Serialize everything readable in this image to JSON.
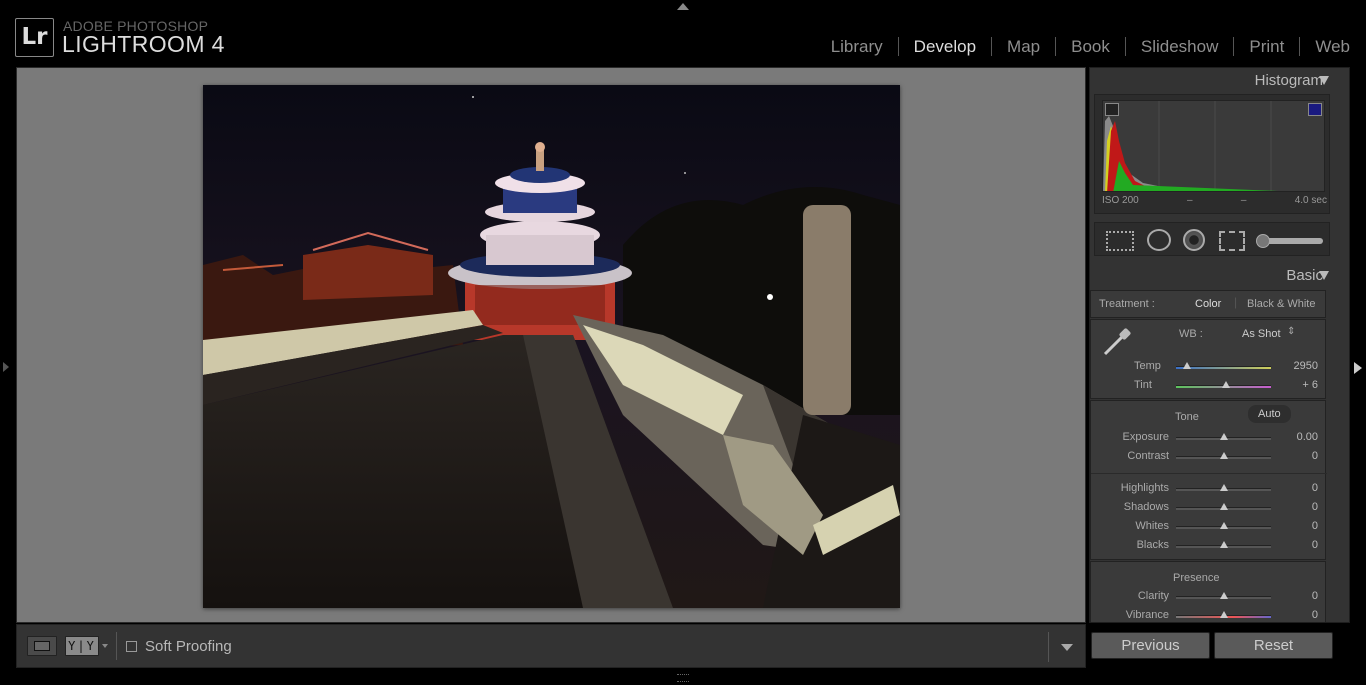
{
  "app": {
    "logo_text": "Lr",
    "brand_top": "ADOBE PHOTOSHOP",
    "brand_main": "LIGHTROOM 4"
  },
  "modules": [
    "Library",
    "Develop",
    "Map",
    "Book",
    "Slideshow",
    "Print",
    "Web"
  ],
  "active_module": "Develop",
  "toolbar": {
    "yy_label": "Y|Y",
    "soft_proofing_label": "Soft Proofing"
  },
  "histogram": {
    "title": "Histogram",
    "iso": "ISO 200",
    "focal": "–",
    "aperture": "–",
    "shutter": "4.0 sec"
  },
  "basic": {
    "title": "Basic",
    "treatment_label": "Treatment :",
    "treatment_color": "Color",
    "treatment_bw": "Black & White",
    "wb_label": "WB :",
    "wb_value": "As Shot",
    "temp_label": "Temp",
    "temp_value": "2950",
    "temp_position": 0.12,
    "tint_label": "Tint",
    "tint_value": "+ 6",
    "tint_position": 0.53,
    "tone_label": "Tone",
    "auto_label": "Auto",
    "sliders_tone": [
      {
        "label": "Exposure",
        "value": "0.00",
        "position": 0.5
      },
      {
        "label": "Contrast",
        "value": "0",
        "position": 0.5
      }
    ],
    "sliders_tone2": [
      {
        "label": "Highlights",
        "value": "0",
        "position": 0.5
      },
      {
        "label": "Shadows",
        "value": "0",
        "position": 0.5
      },
      {
        "label": "Whites",
        "value": "0",
        "position": 0.5
      },
      {
        "label": "Blacks",
        "value": "0",
        "position": 0.5
      }
    ],
    "presence_label": "Presence",
    "sliders_presence": [
      {
        "label": "Clarity",
        "value": "0",
        "position": 0.5
      },
      {
        "label": "Vibrance",
        "value": "0",
        "position": 0.5
      }
    ]
  },
  "buttons": {
    "previous": "Previous",
    "reset": "Reset"
  }
}
